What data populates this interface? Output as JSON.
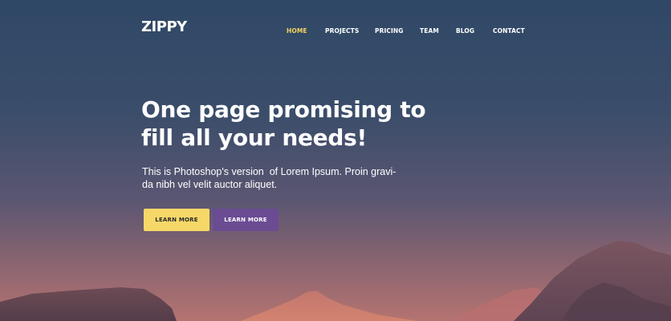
{
  "brand": {
    "logo": "ZIPPY"
  },
  "nav": {
    "items": [
      {
        "label": "HOME",
        "active": true
      },
      {
        "label": "PROJECTS",
        "active": false
      },
      {
        "label": "PRICING",
        "active": false
      },
      {
        "label": "TEAM",
        "active": false
      },
      {
        "label": "BLOG",
        "active": false
      },
      {
        "label": "CONTACT",
        "active": false
      }
    ]
  },
  "hero": {
    "headline_line1": "One page promising to",
    "headline_line2": "fill all your needs!",
    "subtext_line1": "This is Photoshop's version  of Lorem Ipsum. Proin gravi-",
    "subtext_line2": "da nibh vel velit auctor aliquet.",
    "buttons": [
      {
        "label": "LEARN MORE",
        "style": "yellow"
      },
      {
        "label": "LEARN MORE",
        "style": "purple"
      }
    ]
  },
  "colors": {
    "accent_yellow": "#f6d868",
    "accent_purple": "#6b4c93",
    "nav_active": "#f4d35e",
    "sky_top": "#2f4866",
    "sky_bottom": "#b57470"
  }
}
